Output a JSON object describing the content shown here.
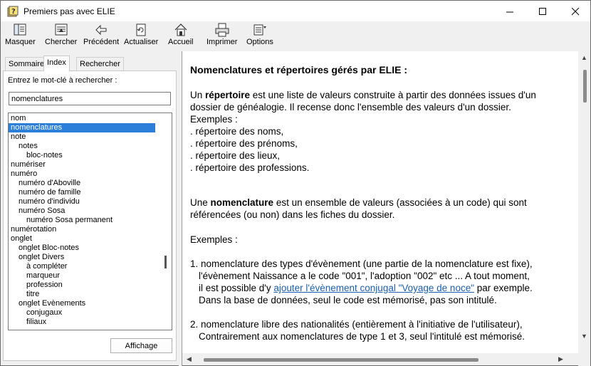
{
  "window": {
    "title": "Premiers pas avec ELIE",
    "controls": [
      "minimize",
      "maximize",
      "close"
    ]
  },
  "toolbar": {
    "items": [
      {
        "label": "Masquer",
        "icon": "hide-pane-icon"
      },
      {
        "label": "Chercher",
        "icon": "locate-icon"
      },
      {
        "label": "Précédent",
        "icon": "back-arrow-icon"
      },
      {
        "label": "Actualiser",
        "icon": "refresh-icon"
      },
      {
        "label": "Accueil",
        "icon": "home-icon"
      },
      {
        "label": "Imprimer",
        "icon": "print-icon"
      },
      {
        "label": "Options",
        "icon": "options-icon"
      }
    ]
  },
  "left_pane": {
    "tabs": [
      {
        "label": "Sommaire",
        "active": false
      },
      {
        "label": "Index",
        "active": true
      },
      {
        "label": "Rechercher",
        "active": false
      }
    ],
    "keyword_label": "Entrez le mot-clé à rechercher :",
    "keyword_value": "nomenclatures",
    "index_items": [
      {
        "text": "nom",
        "level": 0,
        "selected": false
      },
      {
        "text": "nomenclatures",
        "level": 0,
        "selected": true
      },
      {
        "text": "note",
        "level": 0,
        "selected": false
      },
      {
        "text": "notes",
        "level": 1,
        "selected": false
      },
      {
        "text": "bloc-notes",
        "level": 2,
        "selected": false
      },
      {
        "text": "numériser",
        "level": 0,
        "selected": false
      },
      {
        "text": "numéro",
        "level": 0,
        "selected": false
      },
      {
        "text": "numéro d'Aboville",
        "level": 1,
        "selected": false
      },
      {
        "text": "numéro de famille",
        "level": 1,
        "selected": false
      },
      {
        "text": "numéro d'individu",
        "level": 1,
        "selected": false
      },
      {
        "text": "numéro Sosa",
        "level": 1,
        "selected": false
      },
      {
        "text": "numéro Sosa permanent",
        "level": 2,
        "selected": false
      },
      {
        "text": "numérotation",
        "level": 0,
        "selected": false
      },
      {
        "text": "onglet",
        "level": 0,
        "selected": false
      },
      {
        "text": "onglet Bloc-notes",
        "level": 1,
        "selected": false
      },
      {
        "text": "onglet Divers",
        "level": 1,
        "selected": false
      },
      {
        "text": "à compléter",
        "level": 2,
        "selected": false
      },
      {
        "text": "marqueur",
        "level": 2,
        "selected": false
      },
      {
        "text": "profession",
        "level": 2,
        "selected": false
      },
      {
        "text": "titre",
        "level": 2,
        "selected": false
      },
      {
        "text": "onglet Evènements",
        "level": 1,
        "selected": false
      },
      {
        "text": "conjugaux",
        "level": 2,
        "selected": false
      },
      {
        "text": "filiaux",
        "level": 2,
        "selected": false
      }
    ],
    "display_button": "Affichage"
  },
  "content": {
    "title": "Nomenclatures et répertoires gérés par ELIE :",
    "p1_a": "Un ",
    "p1_b": "répertoire",
    "p1_c": " est une liste de valeurs construite à partir des données issues d'un",
    "p1_line2": "dossier de généalogie. Il recense donc l'ensemble des valeurs d'un dossier.",
    "examples_label1": "Exemples :",
    "list1": [
      ". répertoire des noms,",
      ". répertoire des prénoms,",
      ". répertoire des lieux,",
      ". répertoire des professions."
    ],
    "p2_a": "Une ",
    "p2_b": "nomenclature",
    "p2_c": " est un ensemble de valeurs (associées à un code) qui sont",
    "p2_line2": "référencées (ou non) dans les fiches du dossier.",
    "examples_label2": "Exemples :",
    "item1_line1": "1. nomenclature des types d'évènement (une partie de la nomenclature est fixe),",
    "item1_line2": "l'évènement Naissance a le code \"001\", l'adoption \"002\" etc ... A tout moment,",
    "item1_line3_a": "il est possible d'y ",
    "item1_link": "ajouter l'évènement conjugal \"Voyage de noce\"",
    "item1_line3_c": " par exemple.",
    "item1_line4": "Dans la base de données, seul le code est mémorisé, pas son intitulé.",
    "item2_line1": "2. nomenclature libre des nationalités (entièrement à l'initiative de l'utilisateur),",
    "item2_line2": "Contrairement aux nomenclatures de type 1 et 3, seul l'intitulé est mémorisé."
  },
  "colors": {
    "selection": "#2b7fd9",
    "link": "#1a5fb4"
  }
}
